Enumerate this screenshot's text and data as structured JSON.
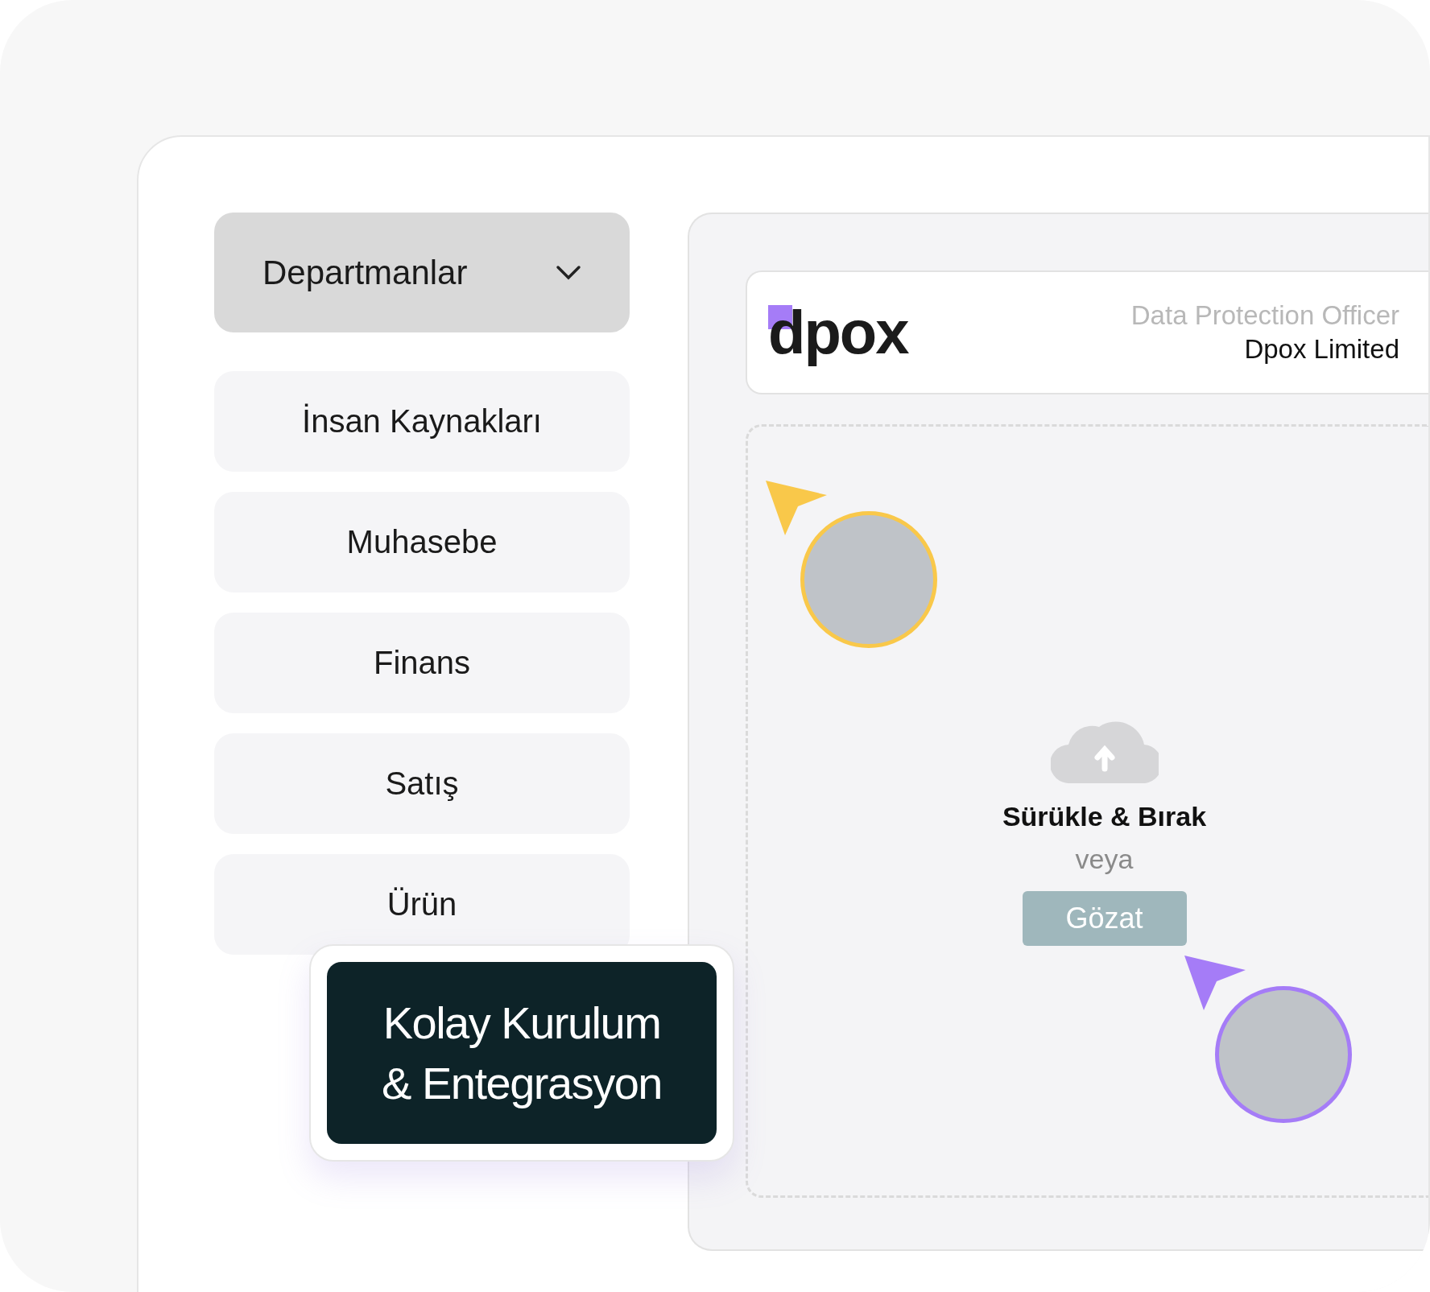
{
  "dropdown": {
    "label": "Departmanlar"
  },
  "departments": [
    {
      "label": "İnsan Kaynakları"
    },
    {
      "label": "Muhasebe"
    },
    {
      "label": "Finans"
    },
    {
      "label": "Satış"
    },
    {
      "label": "Ürün"
    }
  ],
  "header": {
    "logo": "dpox",
    "role": "Data Protection Officer",
    "company": "Dpox Limited"
  },
  "upload": {
    "title": "Sürükle & Bırak",
    "separator": "veya",
    "button": "Gözat"
  },
  "avatars": [
    {
      "color": "#f9c84a"
    },
    {
      "color": "#a57cf7"
    }
  ],
  "callout": {
    "lines": [
      "Kolay Kurulum",
      "& Entegrasyon"
    ]
  }
}
